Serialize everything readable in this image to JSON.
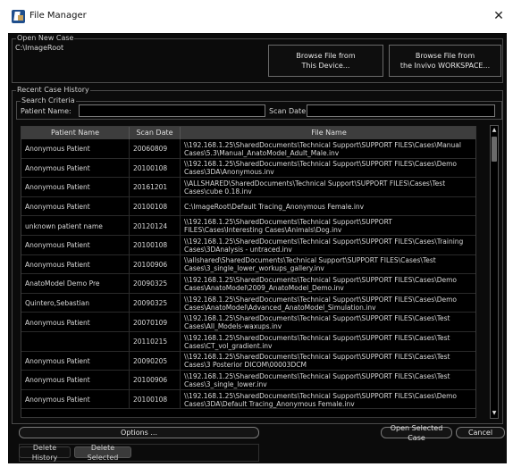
{
  "window": {
    "title": "File Manager",
    "close_glyph": "✕",
    "app_icon": "file-manager-icon"
  },
  "open_new_case": {
    "group_label": "Open New Case",
    "path": "C:\\ImageRoot",
    "browse_device_line1": "Browse File from",
    "browse_device_line2": "This Device...",
    "browse_workspace_line1": "Browse File from",
    "browse_workspace_line2": "the Invivo WORKSPACE..."
  },
  "recent_history": {
    "group_label": "Recent Case History",
    "search_group_label": "Search Criteria",
    "patient_name_label": "Patient Name:",
    "patient_name_value": "",
    "scan_date_label": "Scan Date:",
    "scan_date_value": ""
  },
  "table": {
    "columns": [
      "Patient Name",
      "Scan Date",
      "File Name"
    ],
    "rows": [
      [
        "Anonymous Patient",
        "20060809",
        "\\\\192.168.1.25\\SharedDocuments\\Technical Support\\SUPPORT FILES\\Cases\\Manual Cases\\5.3\\Manual_AnatoModel_Adult_Male.inv"
      ],
      [
        "Anonymous Patient",
        "20100108",
        "\\\\192.168.1.25\\SharedDocuments\\Technical Support\\SUPPORT FILES\\Cases\\Demo Cases\\3DA\\Anonymous.inv"
      ],
      [
        "Anonymous Patient",
        "20161201",
        "\\\\ALLSHARED\\SharedDocuments\\Technical Support\\SUPPORT FILES\\Cases\\Test Cases\\cube 0.18.inv"
      ],
      [
        "Anonymous Patient",
        "20100108",
        "C:\\ImageRoot\\Default Tracing_Anonymous Female.inv"
      ],
      [
        "unknown patient name",
        "20120124",
        "\\\\192.168.1.25\\SharedDocuments\\Technical Support\\SUPPORT FILES\\Cases\\Interesting Cases\\Animals\\Dog.inv"
      ],
      [
        "Anonymous Patient",
        "20100108",
        "\\\\192.168.1.25\\SharedDocuments\\Technical Support\\SUPPORT FILES\\Cases\\Training Cases\\3DAnalysis - untraced.inv"
      ],
      [
        "Anonymous Patient",
        "20100906",
        "\\\\allshared\\SharedDocuments\\Technical Support\\SUPPORT FILES\\Cases\\Test Cases\\3_single_lower_workups_gallery.inv"
      ],
      [
        "AnatoModel Demo Pre",
        "20090325",
        "\\\\192.168.1.25\\SharedDocuments\\Technical Support\\SUPPORT FILES\\Cases\\Demo Cases\\AnatoModel\\2009_AnatoModel_Demo.inv"
      ],
      [
        "Quintero,Sebastian",
        "20090325",
        "\\\\192.168.1.25\\SharedDocuments\\Technical Support\\SUPPORT FILES\\Cases\\Demo Cases\\AnatoModel\\Advanced_AnatoModel_Simulation.inv"
      ],
      [
        "Anonymous Patient",
        "20070109",
        "\\\\192.168.1.25\\SharedDocuments\\Technical Support\\SUPPORT FILES\\Cases\\Test Cases\\All_Models-waxups.inv"
      ],
      [
        "",
        "20110215",
        "\\\\192.168.1.25\\SharedDocuments\\Technical Support\\SUPPORT FILES\\Cases\\Test Cases\\CT_vol_gradient.inv"
      ],
      [
        "Anonymous Patient",
        "20090205",
        "\\\\192.168.1.25\\SharedDocuments\\Technical Support\\SUPPORT FILES\\Cases\\Test Cases\\3 Posterior DICOM\\00003DCM"
      ],
      [
        "Anonymous Patient",
        "20100906",
        "\\\\192.168.1.25\\SharedDocuments\\Technical Support\\SUPPORT FILES\\Cases\\Test Cases\\3_single_lower.inv"
      ],
      [
        "Anonymous Patient",
        "20100108",
        "\\\\192.168.1.25\\SharedDocuments\\Technical Support\\SUPPORT FILES\\Cases\\Demo Cases\\3DA\\Default Tracing_Anonymous Female.inv"
      ]
    ]
  },
  "scroll": {
    "up_glyph": "▲",
    "down_glyph": "▼"
  },
  "footer": {
    "options_label": "Options ...",
    "open_selected_label": "Open Selected Case",
    "cancel_label": "Cancel",
    "delete_history_label": "Delete History",
    "delete_selected_label": "Delete Selected"
  },
  "colors": {
    "background": "#0b0b0b",
    "header": "#3d3d3d",
    "text": "#d8d8d8"
  }
}
